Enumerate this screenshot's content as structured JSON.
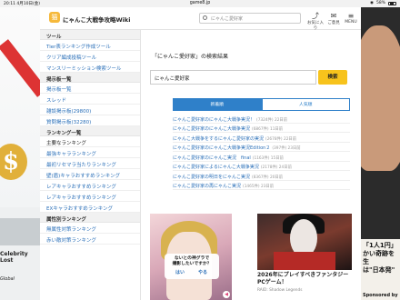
{
  "status_bar": {
    "time": "20:11",
    "date": "4月10日(金)",
    "url": "game8.jp",
    "wifi": "◉",
    "battery": "58%"
  },
  "ad_left": {
    "text1": "",
    "text2": "Celebrity\nLost",
    "text3": "Global"
  },
  "ad_right": {
    "text1": "「1人1円」\nかい奇跡を生\nは\"日本発\"",
    "sponsored": "Sponsored by"
  },
  "header": {
    "site_title": "にゃんこ大戦争攻略Wiki",
    "search_placeholder": "にゃんこ愛好家",
    "icons": [
      {
        "icon": "share-icon",
        "label": "お気に入り"
      },
      {
        "icon": "mail-icon",
        "label": "ご意見"
      },
      {
        "icon": "menu-icon",
        "label": "MENU"
      }
    ]
  },
  "sidebar": {
    "sections": [
      {
        "heading": "ツール",
        "links": [
          "Tier表ランキング作成ツール",
          "クリア編成投稿ツール",
          "マンスリーミッション検索ツール"
        ]
      },
      {
        "heading": "掲示板一覧",
        "links": [
          "掲示板一覧",
          "スレッド",
          "雑談掲示板(29800)",
          "質問掲示板(32280)"
        ]
      },
      {
        "heading": "ランキング一覧",
        "links": [
          "最強キャラランキング",
          "最強キャラランキング",
          "最初リセマラ当たりランキング",
          "壁(盾)キャラおすすめランキング",
          "レアキャラおすすめランキング",
          "レアキャラおすすめランキング",
          "EXキャラおすすめランキング"
        ]
      },
      {
        "heading": "属性別ランキング",
        "links": [
          "無属性対策ランキング",
          "赤い敵対策ランキング"
        ]
      }
    ],
    "extra_headings": [
      "主要なランキング"
    ]
  },
  "main": {
    "result_title": "「にゃんこ愛好家」の検索結果",
    "query_value": "にゃんこ愛好家",
    "search_button": "検索",
    "tabs": [
      "新着順",
      "人気順"
    ],
    "results": [
      {
        "title": "にゃんこ愛好家のにゃんこ大戦争実況！",
        "meta": "(7324件) 22日前"
      },
      {
        "title": "にゃんこ愛好家のにゃんこ大戦争実況",
        "meta": "(6867件) 11日前"
      },
      {
        "title": "にゃんこ大戦争をするにゃんこ愛好家の実況",
        "meta": "(2678件) 22日前"
      },
      {
        "title": "にゃんこ愛好家のにゃんこ大戦争実況Edition２",
        "meta": "(397件) 23日前"
      },
      {
        "title": "にゃんこ愛好家のにゃんこ実況　final",
        "meta": "(1163件) 15日前"
      },
      {
        "title": "にゃんこ愛好家によるにゃんこ大戦争実況",
        "meta": "(2178件) 24日前"
      },
      {
        "title": "にゃんこ愛好家の明日をにゃんこ実況",
        "meta": "(8367件) 20日前"
      },
      {
        "title": "にゃんこ愛好家の再にゃんこ実況",
        "meta": "(1465件) 23日前"
      }
    ],
    "ad1": {
      "dialog": "ないとの神グラで\n撮影したいですか？",
      "yes": "はい",
      "no": "やる",
      "vol": "◀"
    },
    "ad2": {
      "title": "2026年にプレイすべきファンタジーPCゲーム！",
      "sub": "RAID: Shadow Legends"
    }
  }
}
